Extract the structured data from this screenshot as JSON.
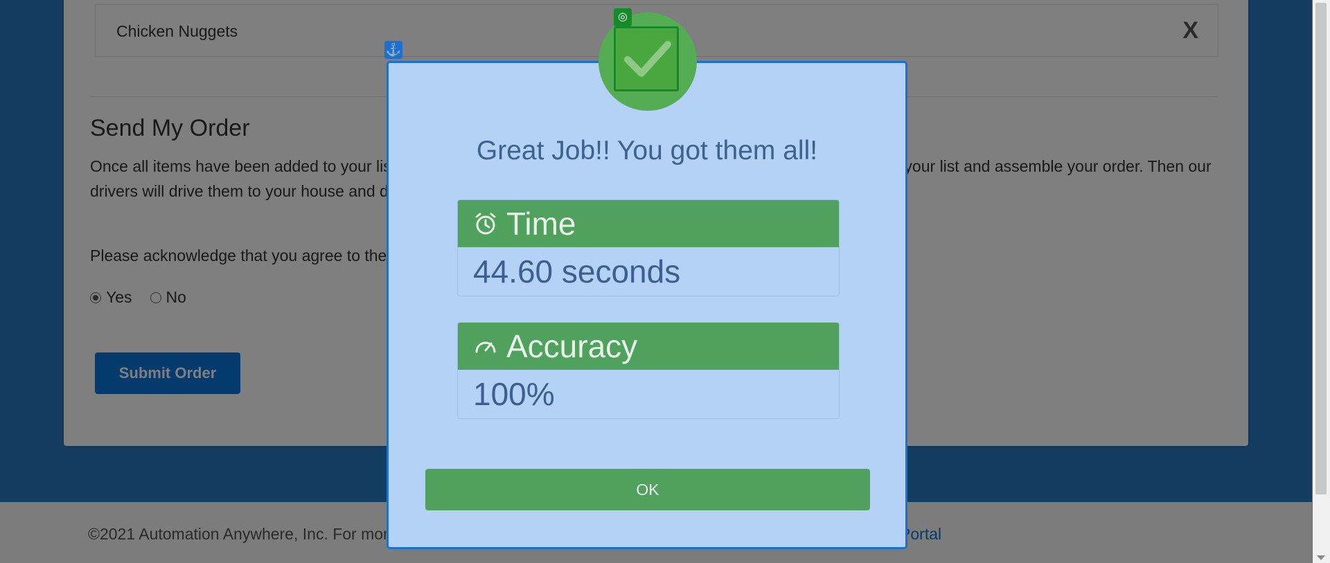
{
  "list": {
    "item_label": "Chicken Nuggets",
    "remove_label": "X"
  },
  "order": {
    "title": "Send My Order",
    "body": "Once all items have been added to your list, submit your order. Our shoppers will go find all items you've entered in your list and assemble your order. Then our drivers will drive them to your house and deliver them to you. We're still working on a robot to do this.",
    "ack_text": "Please acknowledge that you agree to the terms",
    "yes_label": "Yes",
    "no_label": "No",
    "selected": "Yes",
    "submit_label": "Submit Order"
  },
  "footer": {
    "text": "©2021 Automation Anywhere, Inc. For more information visit",
    "link": "r Portal"
  },
  "modal": {
    "title": "Great Job!! You got them all!",
    "time_label": "Time",
    "time_value": "44.60 seconds",
    "accuracy_label": "Accuracy",
    "accuracy_value": "100%",
    "ok_label": "OK"
  },
  "colors": {
    "accent_blue": "#0a74d8",
    "success_green": "#50a05e",
    "modal_bg": "#b4d2f5"
  }
}
